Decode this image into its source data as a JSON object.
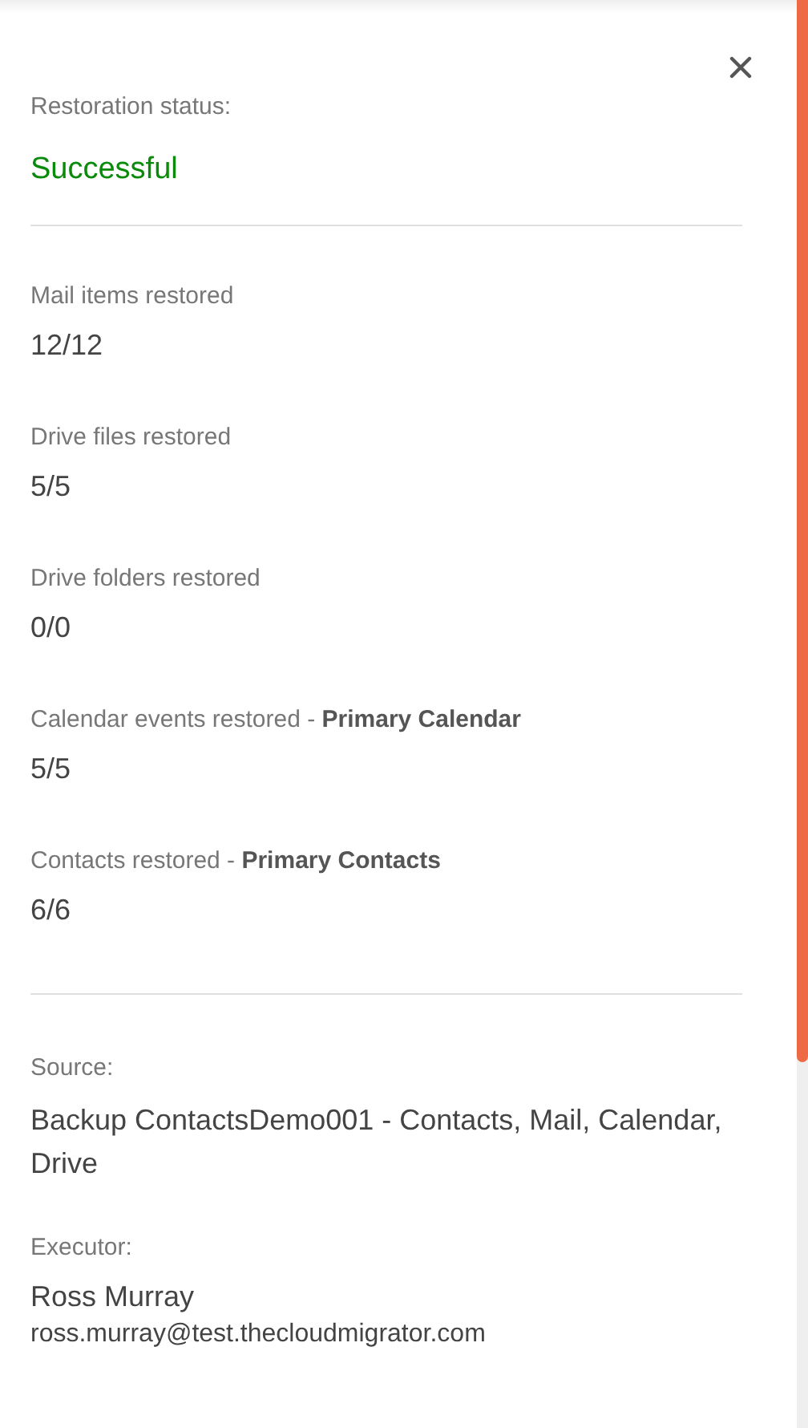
{
  "status": {
    "label": "Restoration status:",
    "value": "Successful",
    "kind": "success"
  },
  "counts": [
    {
      "label": "Mail items restored",
      "value": "12/12"
    },
    {
      "label": "Drive files restored",
      "value": "5/5"
    },
    {
      "label": "Drive folders restored",
      "value": "0/0"
    },
    {
      "label": "Calendar events restored - **Primary Calendar**",
      "value": "5/5"
    },
    {
      "label": "Contacts restored - **Primary Contacts**",
      "value": "6/6"
    }
  ],
  "source": {
    "label": "Source:",
    "value": "Backup ContactsDemo001 - Contacts, Mail, Calendar, Drive"
  },
  "executor": {
    "label": "Executor:",
    "name": "Ross Murray",
    "email": "ross.murray@test.thecloudmigrator.com"
  }
}
